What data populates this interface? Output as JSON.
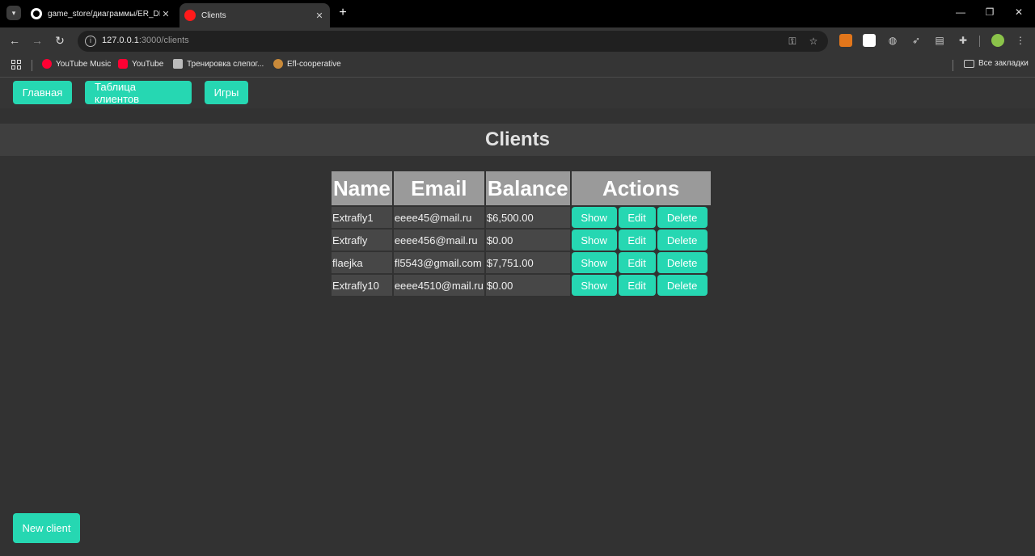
{
  "browser": {
    "tabs": [
      {
        "title": "game_store/диаграммы/ER_DI..."
      },
      {
        "title": "Clients"
      }
    ],
    "url_host": "127.0.0.1",
    "url_path": ":3000/clients",
    "bookmarks": [
      {
        "label": "YouTube Music"
      },
      {
        "label": "YouTube"
      },
      {
        "label": "Тренировка слепог..."
      },
      {
        "label": "Efl-cooperative"
      }
    ],
    "all_bookmarks_label": "Все закладки"
  },
  "nav": {
    "links": [
      {
        "label": "Главная"
      },
      {
        "label": "Таблица клиентов"
      },
      {
        "label": "Игры"
      }
    ]
  },
  "page": {
    "title": "Clients",
    "table": {
      "headers": [
        "Name",
        "Email",
        "Balance",
        "Actions"
      ],
      "rows": [
        {
          "name": "Extrafly1",
          "email": "eeee45@mail.ru",
          "balance": "$6,500.00"
        },
        {
          "name": "Extrafly",
          "email": "eeee456@mail.ru",
          "balance": "$0.00"
        },
        {
          "name": "flaejka",
          "email": "fl5543@gmail.com",
          "balance": "$7,751.00"
        },
        {
          "name": "Extrafly10",
          "email": "eeee4510@mail.ru",
          "balance": "$0.00"
        }
      ],
      "actions": {
        "show": "Show",
        "edit": "Edit",
        "delete": "Delete"
      }
    },
    "new_client_label": "New client"
  },
  "colors": {
    "accent": "#26d7b2",
    "page_bg": "#323232",
    "header_cell_bg": "#9a9a9a"
  }
}
